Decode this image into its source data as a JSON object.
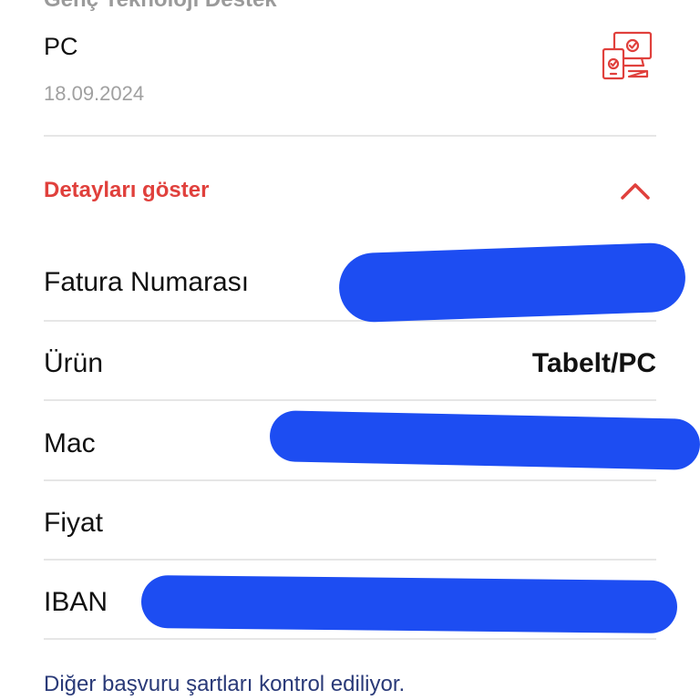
{
  "header": {
    "cut_title": "Genç Teknoloji Destek",
    "item_title": "PC",
    "date": "18.09.2024",
    "icon": "devices-icon"
  },
  "details": {
    "toggle_label": "Detayları göster",
    "toggle_icon": "chevron-up-icon",
    "accent_color": "#e0403c"
  },
  "rows": [
    {
      "label": "Fatura Numarası",
      "value": ""
    },
    {
      "label": "Ürün",
      "value": "Tabelt/PC"
    },
    {
      "label": "Mac",
      "value": ""
    },
    {
      "label": "Fiyat",
      "value": ""
    },
    {
      "label": "IBAN",
      "value": ""
    }
  ],
  "footer": {
    "message": "Diğer başvuru şartları kontrol ediliyor."
  },
  "redaction_color": "#1d4df2"
}
